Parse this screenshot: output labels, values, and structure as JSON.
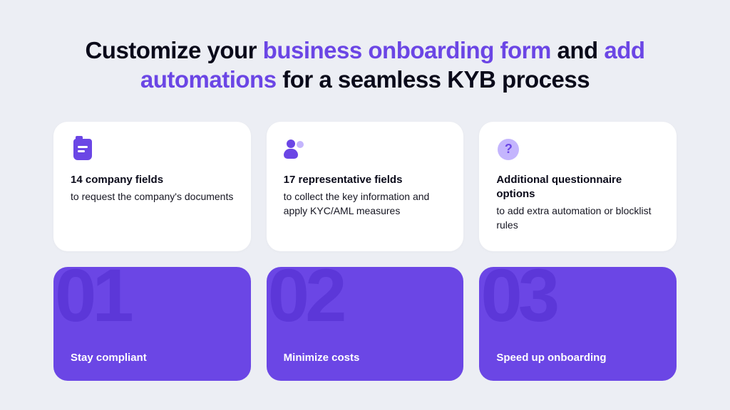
{
  "headline": {
    "part1": "Customize your ",
    "accent1": "business onboarding form",
    "part2": " and ",
    "accent2": "add automations",
    "part3": " for a seamless KYB process"
  },
  "cards": [
    {
      "icon_name": "document-icon",
      "title": "14 company fields",
      "desc": "to request the company's documents"
    },
    {
      "icon_name": "people-icon",
      "title": "17 representative fields",
      "desc": "to collect the key information and apply KYC/AML measures"
    },
    {
      "icon_name": "question-icon",
      "title": "Additional questionnaire options",
      "desc": "to add extra automation or blocklist rules"
    }
  ],
  "tiles": [
    {
      "number": "01",
      "label": "Stay compliant"
    },
    {
      "number": "02",
      "label": "Minimize costs"
    },
    {
      "number": "03",
      "label": "Speed up onboarding"
    }
  ],
  "colors": {
    "accent": "#6b46e5",
    "accent_dark": "#5c37d8",
    "accent_light": "#c4b5fd",
    "bg": "#eceef4"
  }
}
